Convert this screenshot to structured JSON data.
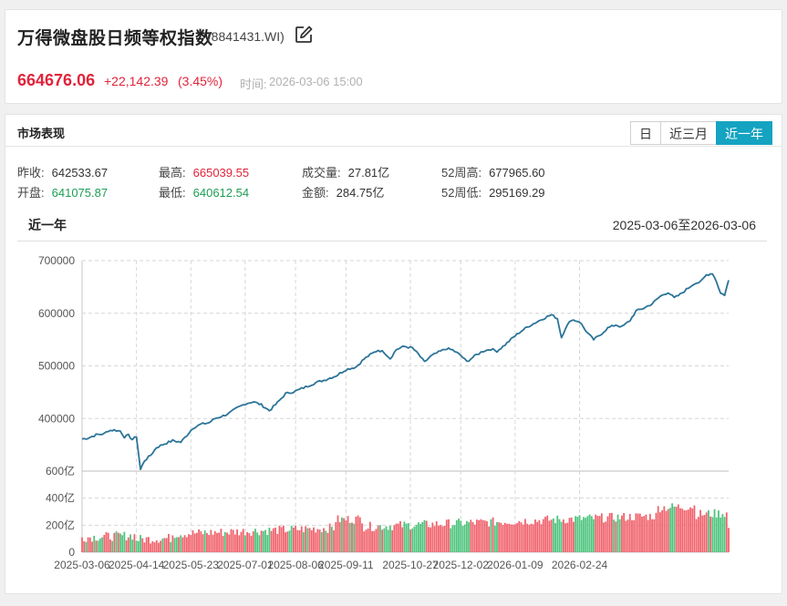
{
  "header": {
    "title": "万得微盘股日频等权指数",
    "code": "(8841431.WI)",
    "price": "664676.06",
    "change": "+22,142.39",
    "change_pct": "(3.45%)",
    "time_label": "时间:",
    "time_value": "2026-03-06 15:00",
    "edit_icon": "edit-icon",
    "colors": {
      "up": "#e2233a",
      "down": "#1c9e54",
      "accent": "#14a3c1"
    }
  },
  "market": {
    "title": "市场表现",
    "tabs": [
      {
        "label": "日",
        "active": false
      },
      {
        "label": "近三月",
        "active": false
      },
      {
        "label": "近一年",
        "active": true
      }
    ],
    "stats": {
      "prev_close_label": "昨收:",
      "prev_close": "642533.67",
      "open_label": "开盘:",
      "open": "641075.87",
      "high_label": "最高:",
      "high": "665039.55",
      "low_label": "最低:",
      "low": "640612.54",
      "volume_label": "成交量:",
      "volume": "27.81亿",
      "amount_label": "金额:",
      "amount": "284.75亿",
      "high52_label": "52周高:",
      "high52": "677965.60",
      "low52_label": "52周低:",
      "low52": "295169.29"
    },
    "range_title": "近一年",
    "range_dates": "2025-03-06至2026-03-06"
  },
  "chart_data": {
    "type": "line",
    "title": "",
    "price_axis": {
      "ticks": [
        "700000",
        "600000",
        "500000",
        "400000"
      ],
      "ylim": [
        300000,
        700000
      ]
    },
    "volume_axis": {
      "unit": "亿",
      "ticks": [
        "600亿",
        "400亿",
        "200亿",
        "0"
      ],
      "ylim": [
        0,
        600
      ]
    },
    "x_ticks": [
      "2025-03-06",
      "2025-04-14",
      "2025-05-23",
      "2025-07-01",
      "2025-08-06",
      "2025-09-11",
      "2025-10-27",
      "2025-12-02",
      "2026-01-09",
      "2026-02-24"
    ],
    "grid": true,
    "line_color": "#2b7499",
    "price_series": [
      [
        0,
        361000
      ],
      [
        3,
        363000
      ],
      [
        7,
        369000
      ],
      [
        11,
        371000
      ],
      [
        13,
        377000
      ],
      [
        16,
        378000
      ],
      [
        19,
        376000
      ],
      [
        21,
        365000
      ],
      [
        23,
        368000
      ],
      [
        25,
        360000
      ],
      [
        27,
        366000
      ],
      [
        29,
        303000
      ],
      [
        31,
        320000
      ],
      [
        34,
        330000
      ],
      [
        37,
        345000
      ],
      [
        41,
        352000
      ],
      [
        45,
        358000
      ],
      [
        49,
        355000
      ],
      [
        52,
        368000
      ],
      [
        55,
        382000
      ],
      [
        59,
        389000
      ],
      [
        63,
        392000
      ],
      [
        66,
        400000
      ],
      [
        70,
        405000
      ],
      [
        73,
        410000
      ],
      [
        77,
        420000
      ],
      [
        81,
        428000
      ],
      [
        85,
        432000
      ],
      [
        89,
        426000
      ],
      [
        93,
        415000
      ],
      [
        97,
        430000
      ],
      [
        101,
        447000
      ],
      [
        106,
        452000
      ],
      [
        111,
        460000
      ],
      [
        116,
        468000
      ],
      [
        121,
        474000
      ],
      [
        126,
        481000
      ],
      [
        131,
        493000
      ],
      [
        136,
        498000
      ],
      [
        140,
        513000
      ],
      [
        143,
        521000
      ],
      [
        147,
        530000
      ],
      [
        150,
        526000
      ],
      [
        153,
        514000
      ],
      [
        156,
        531000
      ],
      [
        160,
        537000
      ],
      [
        164,
        534000
      ],
      [
        167,
        522000
      ],
      [
        170,
        507000
      ],
      [
        173,
        518000
      ],
      [
        177,
        526000
      ],
      [
        181,
        533000
      ],
      [
        184,
        530000
      ],
      [
        188,
        520000
      ],
      [
        191,
        508000
      ],
      [
        195,
        519000
      ],
      [
        199,
        528000
      ],
      [
        203,
        532000
      ],
      [
        206,
        528000
      ],
      [
        210,
        540000
      ],
      [
        214,
        554000
      ],
      [
        218,
        566000
      ],
      [
        222,
        576000
      ],
      [
        226,
        584000
      ],
      [
        230,
        592000
      ],
      [
        233,
        597000
      ],
      [
        236,
        590000
      ],
      [
        238,
        554000
      ],
      [
        240,
        572000
      ],
      [
        243,
        588000
      ],
      [
        247,
        584000
      ],
      [
        251,
        562000
      ],
      [
        254,
        550000
      ],
      [
        257,
        558000
      ],
      [
        261,
        572000
      ],
      [
        265,
        578000
      ],
      [
        268,
        574000
      ],
      [
        272,
        586000
      ],
      [
        275,
        604000
      ],
      [
        279,
        610000
      ],
      [
        283,
        618000
      ],
      [
        287,
        632000
      ],
      [
        291,
        640000
      ],
      [
        294,
        629000
      ],
      [
        297,
        636000
      ],
      [
        301,
        648000
      ],
      [
        304,
        657000
      ],
      [
        307,
        659000
      ],
      [
        310,
        673000
      ],
      [
        313,
        676000
      ],
      [
        315,
        660000
      ],
      [
        317,
        638000
      ],
      [
        319,
        635000
      ],
      [
        321,
        662000
      ]
    ],
    "volume_note": "Daily turnover bars (亿), red = up day, green = down day"
  }
}
